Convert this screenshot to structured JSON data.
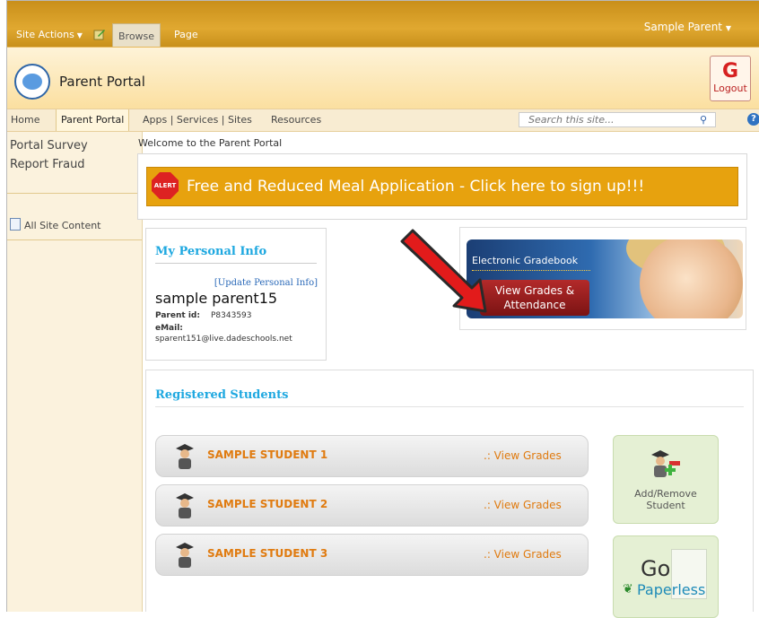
{
  "ribbon": {
    "site_actions": "Site Actions",
    "tab_browse": "Browse",
    "tab_page": "Page",
    "user": "Sample Parent"
  },
  "header": {
    "site_title": "Parent Portal",
    "logout": "Logout"
  },
  "topnav": {
    "items": [
      "Home",
      "Parent Portal",
      "Apps | Services | Sites",
      "Resources"
    ],
    "search_placeholder": "Search this site..."
  },
  "sidebar": {
    "items": [
      "Portal Survey",
      "Report Fraud"
    ],
    "all_content": "All Site Content"
  },
  "main": {
    "breadcrumb": "Welcome to the Parent Portal",
    "alert_badge": "ALERT",
    "alert_text": "Free and Reduced Meal Application - Click here to sign up!!!",
    "personal_info": {
      "title": "My Personal Info",
      "update_link": "[Update Personal Info]",
      "name": "sample parent15",
      "parent_id_label": "Parent id:",
      "parent_id": "P8343593",
      "email_label": "eMail:",
      "email": "sparent151@live.dadeschools.net"
    },
    "gradebook": {
      "title": "Electronic Gradebook",
      "button": "View Grades & Attendance"
    },
    "students": {
      "title": "Registered Students",
      "list": [
        {
          "name": "SAMPLE STUDENT 1",
          "link": ".: View Grades"
        },
        {
          "name": "SAMPLE STUDENT 2",
          "link": ".: View Grades"
        },
        {
          "name": "SAMPLE STUDENT 3",
          "link": ".: View Grades"
        }
      ],
      "add_remove": "Add/Remove Student",
      "go": "Go",
      "paperless": "Paperless"
    }
  }
}
